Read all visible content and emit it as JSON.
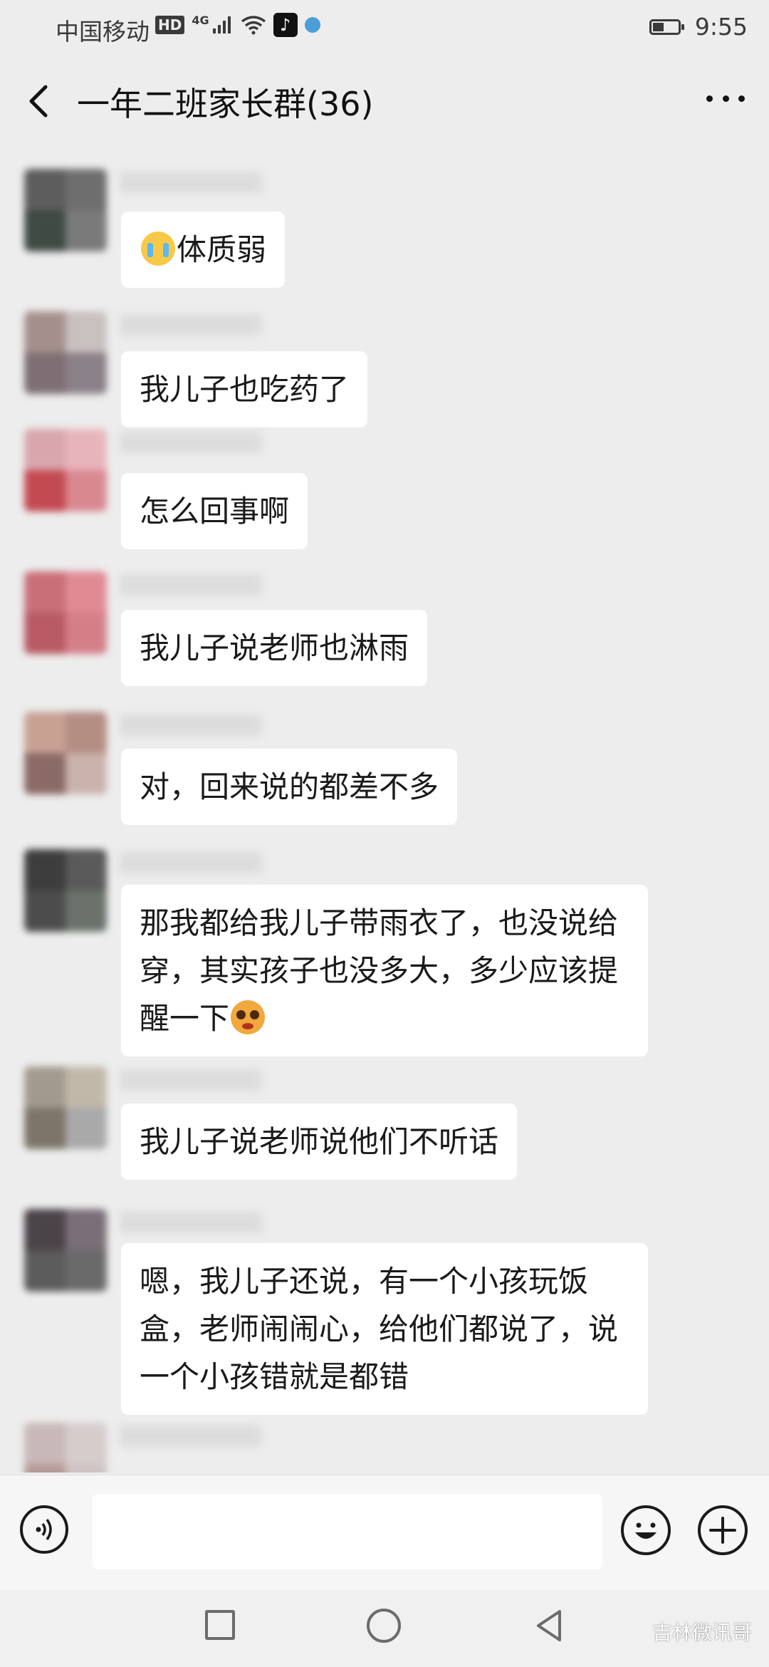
{
  "status_bar": {
    "carrier": "中国移动",
    "hd": "HD",
    "network": "4G",
    "time": "9:55",
    "icons": [
      "hd-icon",
      "signal-icon",
      "wifi-icon",
      "tiktok-icon",
      "app-icon",
      "battery-icon"
    ]
  },
  "header": {
    "title": "一年二班家长群(36)"
  },
  "messages": [
    {
      "text": "体质弱",
      "emoji": "crying-emoji"
    },
    {
      "text": "我儿子也吃药了"
    },
    {
      "text": "怎么回事啊"
    },
    {
      "text": "我儿子说老师也淋雨"
    },
    {
      "text": "对，回来说的都差不多"
    },
    {
      "text": "那我都给我儿子带雨衣了，也没说给穿，其实孩子也没多大，多少应该提醒一下",
      "emoji": "pleading-emoji"
    },
    {
      "text": "我儿子说老师说他们不听话"
    },
    {
      "text": "嗯，我儿子还说，有一个小孩玩饭盒，老师闹闹心，给他们都说了，说一个小孩错就是都错"
    }
  ],
  "input": {
    "value": "",
    "icons": [
      "voice-icon",
      "emoji-icon",
      "plus-icon"
    ]
  },
  "watermark": "吉林微讯哥",
  "colors": {
    "background": "#ededed",
    "bubble": "#ffffff",
    "text": "#1a1a1a"
  }
}
